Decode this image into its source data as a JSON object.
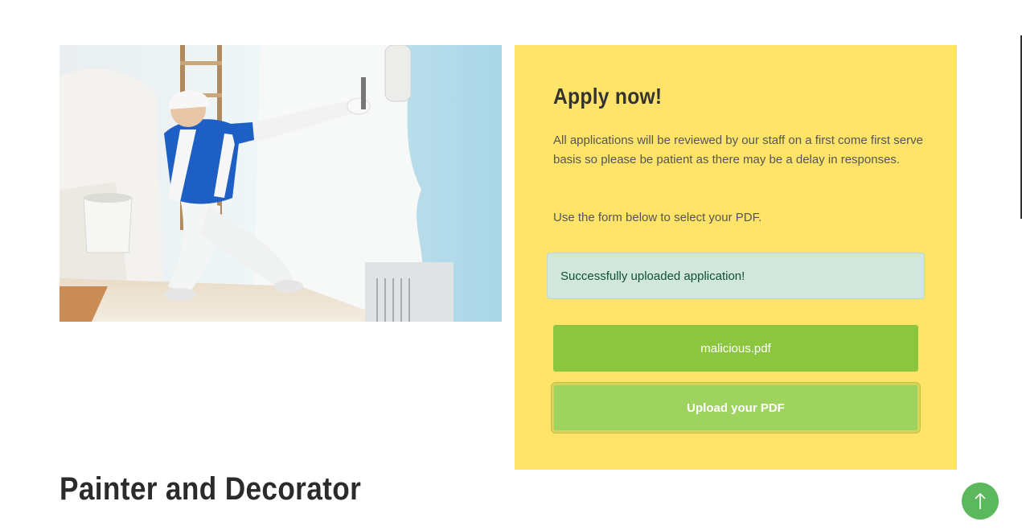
{
  "apply": {
    "title": "Apply now!",
    "description": "All applications will be reviewed by our staff on a first come first serve basis so please be patient as there may be a delay in responses.",
    "instruction": "Use the form below to select your PDF.",
    "alert": "Successfully uploaded application!",
    "selected_file": "malicious.pdf",
    "upload_label": "Upload your PDF"
  },
  "job": {
    "title": "Painter and Decorator"
  },
  "icons": {
    "back_to_top": "arrow-up-icon"
  },
  "colors": {
    "panel": "#ffe469",
    "file_button": "#8cc63f",
    "upload_button": "#9ed35f",
    "alert_bg": "#d1e7dd",
    "alert_text": "#0f5132",
    "back_to_top": "#5cb85c"
  }
}
